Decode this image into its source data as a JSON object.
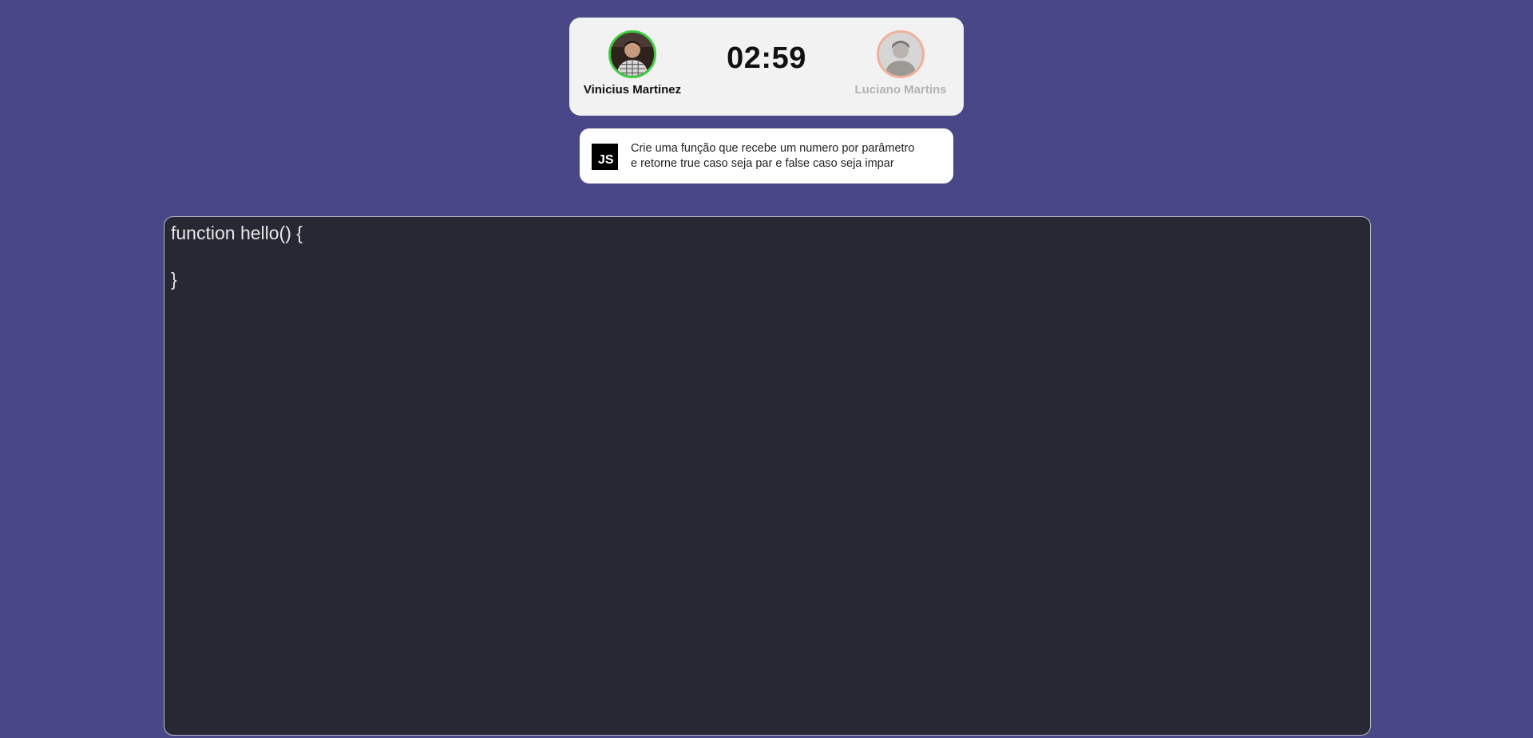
{
  "players": {
    "left": {
      "name": "Vinicius Martinez",
      "status": "active",
      "ring_color": "#3fcd3f"
    },
    "right": {
      "name": "Luciano Martins",
      "status": "inactive",
      "ring_color": "#f0b09a"
    }
  },
  "timer": {
    "value": "02:59"
  },
  "challenge": {
    "language_badge": "JS",
    "line1": "Crie uma função que recebe um numero por parâmetro",
    "line2": "e retorne true caso seja par e false caso seja impar"
  },
  "editor": {
    "lines": [
      "function hello() {",
      "",
      "}"
    ]
  },
  "colors": {
    "background": "#4a4788",
    "editor_background": "#272833",
    "card_background": "#f2f2f2"
  }
}
